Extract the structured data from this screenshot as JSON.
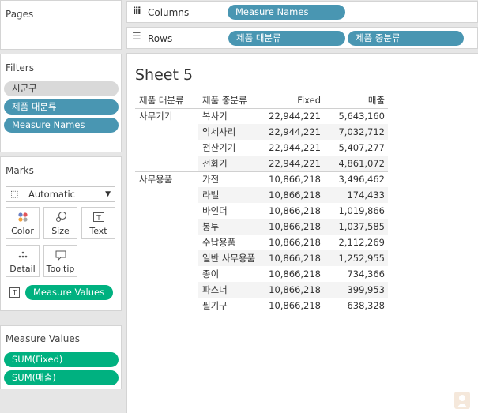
{
  "pages": {
    "title": "Pages"
  },
  "filters": {
    "title": "Filters",
    "items": [
      "시군구",
      "제품 대분류",
      "Measure Names"
    ]
  },
  "marks": {
    "title": "Marks",
    "type": "Automatic",
    "buttons": [
      "Color",
      "Size",
      "Text",
      "Detail",
      "Tooltip"
    ],
    "measure_pill": "Measure Values"
  },
  "measure_values": {
    "title": "Measure Values",
    "items": [
      "SUM(Fixed)",
      "SUM(매출)"
    ]
  },
  "columns": {
    "label": "Columns",
    "pill": "Measure Names"
  },
  "rows": {
    "label": "Rows",
    "pills": [
      "제품 대분류",
      "제품 중분류"
    ]
  },
  "sheet": {
    "title": "Sheet 5",
    "headers": [
      "제품 대분류",
      "제품 중분류",
      "Fixed",
      "매출"
    ],
    "rows": [
      {
        "group": "사무기기",
        "sub": "복사기",
        "fixed": "22,944,221",
        "sales": "5,643,160"
      },
      {
        "group": "",
        "sub": "악세사리",
        "fixed": "22,944,221",
        "sales": "7,032,712"
      },
      {
        "group": "",
        "sub": "전산기기",
        "fixed": "22,944,221",
        "sales": "5,407,277"
      },
      {
        "group": "",
        "sub": "전화기",
        "fixed": "22,944,221",
        "sales": "4,861,072"
      },
      {
        "group": "사무용품",
        "sub": "가전",
        "fixed": "10,866,218",
        "sales": "3,496,462"
      },
      {
        "group": "",
        "sub": "라벨",
        "fixed": "10,866,218",
        "sales": "174,433"
      },
      {
        "group": "",
        "sub": "바인더",
        "fixed": "10,866,218",
        "sales": "1,019,866"
      },
      {
        "group": "",
        "sub": "봉투",
        "fixed": "10,866,218",
        "sales": "1,037,585"
      },
      {
        "group": "",
        "sub": "수납용품",
        "fixed": "10,866,218",
        "sales": "2,112,269"
      },
      {
        "group": "",
        "sub": "일반 사무용품",
        "fixed": "10,866,218",
        "sales": "1,252,955"
      },
      {
        "group": "",
        "sub": "종이",
        "fixed": "10,866,218",
        "sales": "734,366"
      },
      {
        "group": "",
        "sub": "파스너",
        "fixed": "10,866,218",
        "sales": "399,953"
      },
      {
        "group": "",
        "sub": "필기구",
        "fixed": "10,866,218",
        "sales": "638,328"
      }
    ]
  },
  "colors": {
    "dimension_pill": "#4996b2",
    "measure_pill": "#00b180",
    "filter_pill": "#d9d9d9"
  }
}
